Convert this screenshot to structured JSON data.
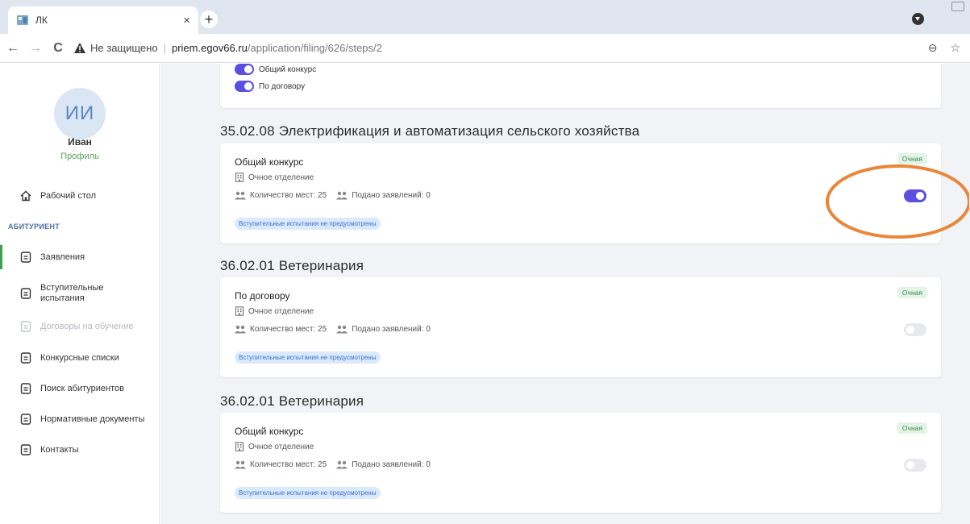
{
  "browser": {
    "tab_title": "ЛК",
    "tab_close": "×",
    "new_tab": "+",
    "back": "←",
    "forward": "→",
    "reload": "C",
    "insecure_label": "Не защищено",
    "separator": "|",
    "url_host": "priem.egov66.ru",
    "url_path": "/application/filing/626/steps/2",
    "zoom_icon": "⊖",
    "bookmark_icon": "☆"
  },
  "sidebar": {
    "avatar_initials": "ИИ",
    "user_name": "Иван",
    "profile_link": "Профиль",
    "desktop": "Рабочий стол",
    "section_label": "АБИТУРИЕНТ",
    "items": [
      {
        "label": "Заявления",
        "state": "active"
      },
      {
        "label": "Вступительные испытания",
        "state": "normal"
      },
      {
        "label": "Договоры на обучение",
        "state": "disabled"
      },
      {
        "label": "Конкурсные списки",
        "state": "normal"
      },
      {
        "label": "Поиск абитуриентов",
        "state": "normal"
      },
      {
        "label": "Нормативные документы",
        "state": "normal"
      },
      {
        "label": "Контакты",
        "state": "normal"
      }
    ]
  },
  "top_card": {
    "toggles": [
      {
        "label": "Общий конкурс",
        "on": true
      },
      {
        "label": "По договору",
        "on": true
      }
    ]
  },
  "sections": [
    {
      "title": "35.02.08 Электрификация и автоматизация сельского хозяйства",
      "card": {
        "name": "Общий конкурс",
        "badge": "Очная",
        "department": "Очное отделение",
        "seats": "Количество мест: 25",
        "applications": "Подано заявлений: 0",
        "exam_note": "Вступительные испытания не предусмотрены",
        "selected": true
      }
    },
    {
      "title": "36.02.01 Ветеринария",
      "card": {
        "name": "По договору",
        "badge": "Очная",
        "department": "Очное отделение",
        "seats": "Количество мест: 25",
        "applications": "Подано заявлений: 0",
        "exam_note": "Вступительные испытания не предусмотрены",
        "selected": false
      }
    },
    {
      "title": "36.02.01 Ветеринария",
      "card": {
        "name": "Общий конкурс",
        "badge": "Очная",
        "department": "Очное отделение",
        "seats": "Количество мест: 25",
        "applications": "Подано заявлений: 0",
        "exam_note": "Вступительные испытания не предусмотрены",
        "selected": false
      }
    }
  ],
  "colors": {
    "toggle_on": "#5a4fe0",
    "badge_green": "#3c8a4d",
    "pill_blue": "#3d6fd1",
    "active_marker": "#3aa34a",
    "annotation_orange": "#e8863a"
  }
}
